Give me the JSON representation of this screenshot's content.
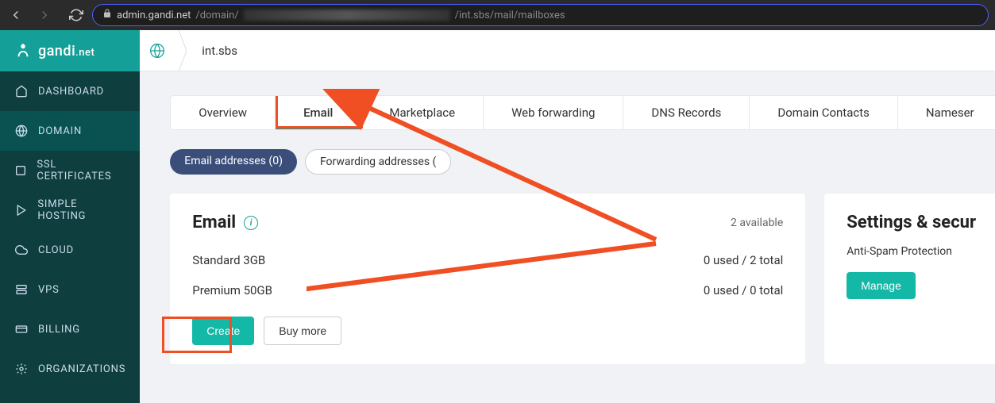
{
  "browser": {
    "url_prefix": "admin.gandi.net",
    "url_path1": "/domain/",
    "url_path2": "/int.sbs/mail/mailboxes"
  },
  "brand": {
    "name": "gandi",
    "tld": ".net"
  },
  "sidebar": {
    "items": [
      {
        "label": "DASHBOARD",
        "icon": "home"
      },
      {
        "label": "DOMAIN",
        "icon": "globe"
      },
      {
        "label": "SSL CERTIFICATES",
        "icon": "cert"
      },
      {
        "label": "SIMPLE HOSTING",
        "icon": "play"
      },
      {
        "label": "CLOUD",
        "icon": "cloud"
      },
      {
        "label": "VPS",
        "icon": "stack"
      },
      {
        "label": "BILLING",
        "icon": "card"
      },
      {
        "label": "ORGANIZATIONS",
        "icon": "org"
      }
    ]
  },
  "breadcrumb": "int.sbs",
  "tabs": [
    {
      "label": "Overview"
    },
    {
      "label": "Email"
    },
    {
      "label": "Marketplace"
    },
    {
      "label": "Web forwarding"
    },
    {
      "label": "DNS Records"
    },
    {
      "label": "Domain Contacts"
    },
    {
      "label": "Nameser"
    }
  ],
  "subtabs": {
    "primary": "Email addresses (0)",
    "secondary": "Forwarding addresses ("
  },
  "emailCard": {
    "title": "Email",
    "available": "2 available",
    "standard": {
      "label": "Standard 3GB",
      "val": "0 used / 2 total"
    },
    "premium": {
      "label": "Premium 50GB",
      "val": "0 used / 0 total"
    },
    "createBtn": "Create",
    "buyBtn": "Buy more"
  },
  "settingsCard": {
    "title": "Settings & secur",
    "antispam": "Anti-Spam Protection",
    "manageBtn": "Manage"
  }
}
